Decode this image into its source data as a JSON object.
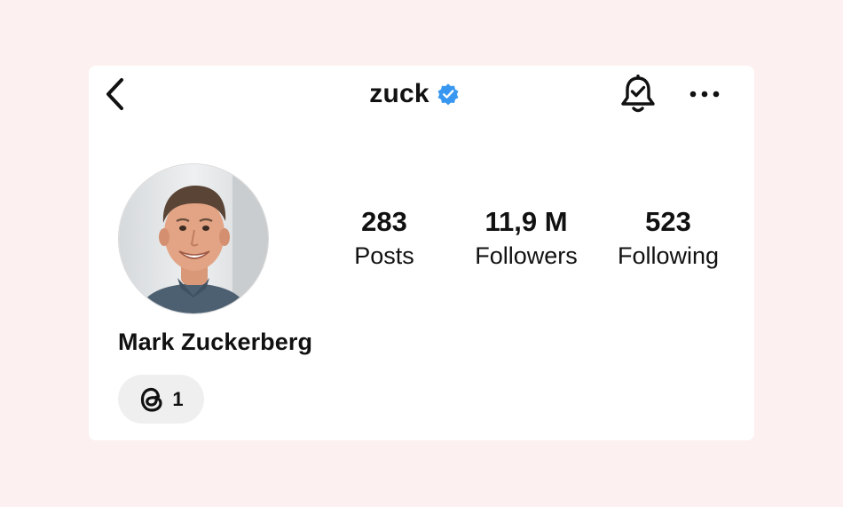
{
  "header": {
    "username": "zuck",
    "verified": true,
    "verified_color": "#3897f0",
    "icons": {
      "back": "chevron-left-icon",
      "verified": "verified-badge-icon",
      "notifications": "bell-check-icon",
      "more": "more-horizontal-icon"
    }
  },
  "profile": {
    "full_name": "Mark Zuckerberg",
    "avatar_icon": "avatar"
  },
  "stats": [
    {
      "value": "283",
      "label": "Posts"
    },
    {
      "value": "11,9 M",
      "label": "Followers"
    },
    {
      "value": "523",
      "label": "Following"
    }
  ],
  "threads_badge": {
    "icon": "threads-icon",
    "count": "1"
  },
  "colors": {
    "page_background": "#fdf0f0",
    "card_background": "#ffffff",
    "pill_background": "#efefef",
    "text": "#111111"
  }
}
